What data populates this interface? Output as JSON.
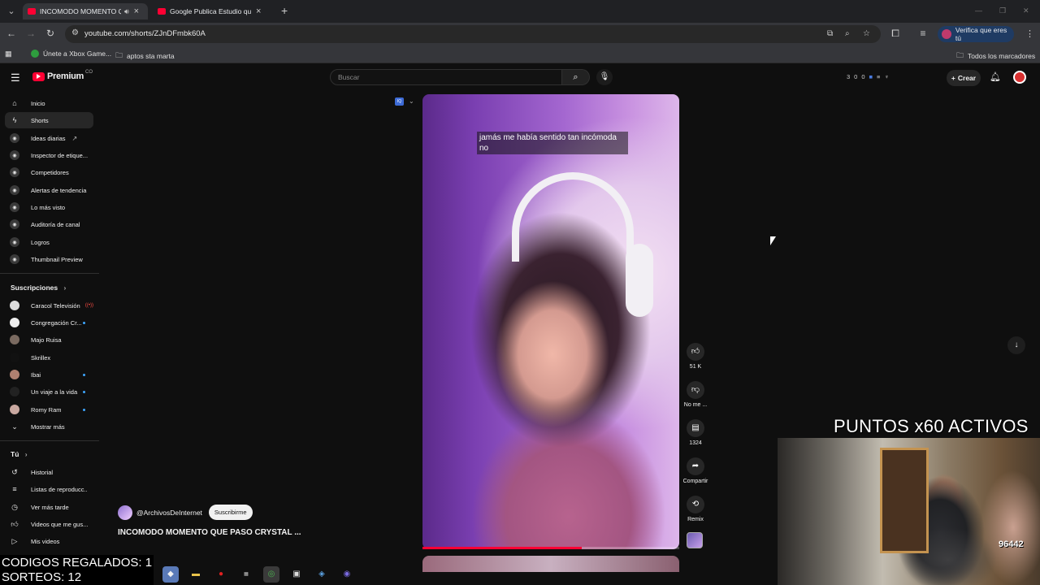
{
  "browser": {
    "tabs": [
      {
        "title": "INCOMODO MOMENTO QUE PASO CRYSTAL",
        "audio_icon": "speaker-icon"
      },
      {
        "title": "Google Publica Estudio que Podría"
      }
    ],
    "url": "youtube.com/shorts/ZJnDFmbk60A",
    "verify_label": "Verifica que eres tú",
    "bookmarks": [
      {
        "label": "Únete a Xbox Game..."
      },
      {
        "label": "aptos sta marta"
      }
    ],
    "all_bookmarks": "Todos los marcadores"
  },
  "youtube": {
    "logo_text": "Premium",
    "logo_suffix": "CO",
    "search_placeholder": "Buscar",
    "ext_stats": [
      "3",
      "0",
      "0"
    ],
    "create_label": "Crear",
    "sidebar": {
      "top_items": [
        {
          "label": "Inicio",
          "icon": "home-icon"
        },
        {
          "label": "Shorts",
          "icon": "shorts-icon",
          "active": true
        },
        {
          "label": "Ideas diarias",
          "icon": "ext-icon"
        },
        {
          "label": "Inspector de etique...",
          "icon": "ext-icon"
        },
        {
          "label": "Competidores",
          "icon": "ext-icon"
        },
        {
          "label": "Alertas de tendencia",
          "icon": "ext-icon"
        },
        {
          "label": "Lo más visto",
          "icon": "ext-icon"
        },
        {
          "label": "Auditoría de canal",
          "icon": "ext-icon"
        },
        {
          "label": "Logros",
          "icon": "ext-icon"
        },
        {
          "label": "Thumbnail Preview",
          "icon": "ext-icon"
        }
      ],
      "subs_heading": "Suscripciones",
      "subscriptions": [
        {
          "label": "Caracol Televisión"
        },
        {
          "label": "Congregación Cr..."
        },
        {
          "label": "Majo Ruisa"
        },
        {
          "label": "Skrillex"
        },
        {
          "label": "Ibai"
        },
        {
          "label": "Un viaje a la vida"
        },
        {
          "label": "Romy Ram"
        },
        {
          "label": "Mostrar más"
        }
      ],
      "you_heading": "Tú",
      "you_items": [
        {
          "label": "Historial",
          "icon": "history-icon"
        },
        {
          "label": "Listas de reproducc...",
          "icon": "playlist-icon"
        },
        {
          "label": "Ver más tarde",
          "icon": "clock-icon"
        },
        {
          "label": "Videos que me gus...",
          "icon": "thumbs-up-icon"
        },
        {
          "label": "Mis videos",
          "icon": "video-icon"
        }
      ]
    },
    "short": {
      "caption": "jamás me había sentido tan incómoda no",
      "channel": "@ArchivosDeInternet",
      "subscribe_label": "Suscribirme",
      "title": "INCOMODO MOMENTO QUE PASO CRYSTAL ...",
      "progress": 0.62,
      "actions": {
        "likes": "51 K",
        "dislike": "No me ...",
        "comments": "1324",
        "share": "Compartir",
        "remix": "Remix"
      }
    }
  },
  "overlay": {
    "points_banner": "PUNTOS x60 ACTIVOS",
    "codes_line1": "CODIGOS REGALADOS: 1",
    "codes_line2": "SORTEOS: 12",
    "webcam_score": "96442"
  },
  "colors": {
    "brand_red": "#ff0033",
    "bg": "#0f0f0f"
  }
}
